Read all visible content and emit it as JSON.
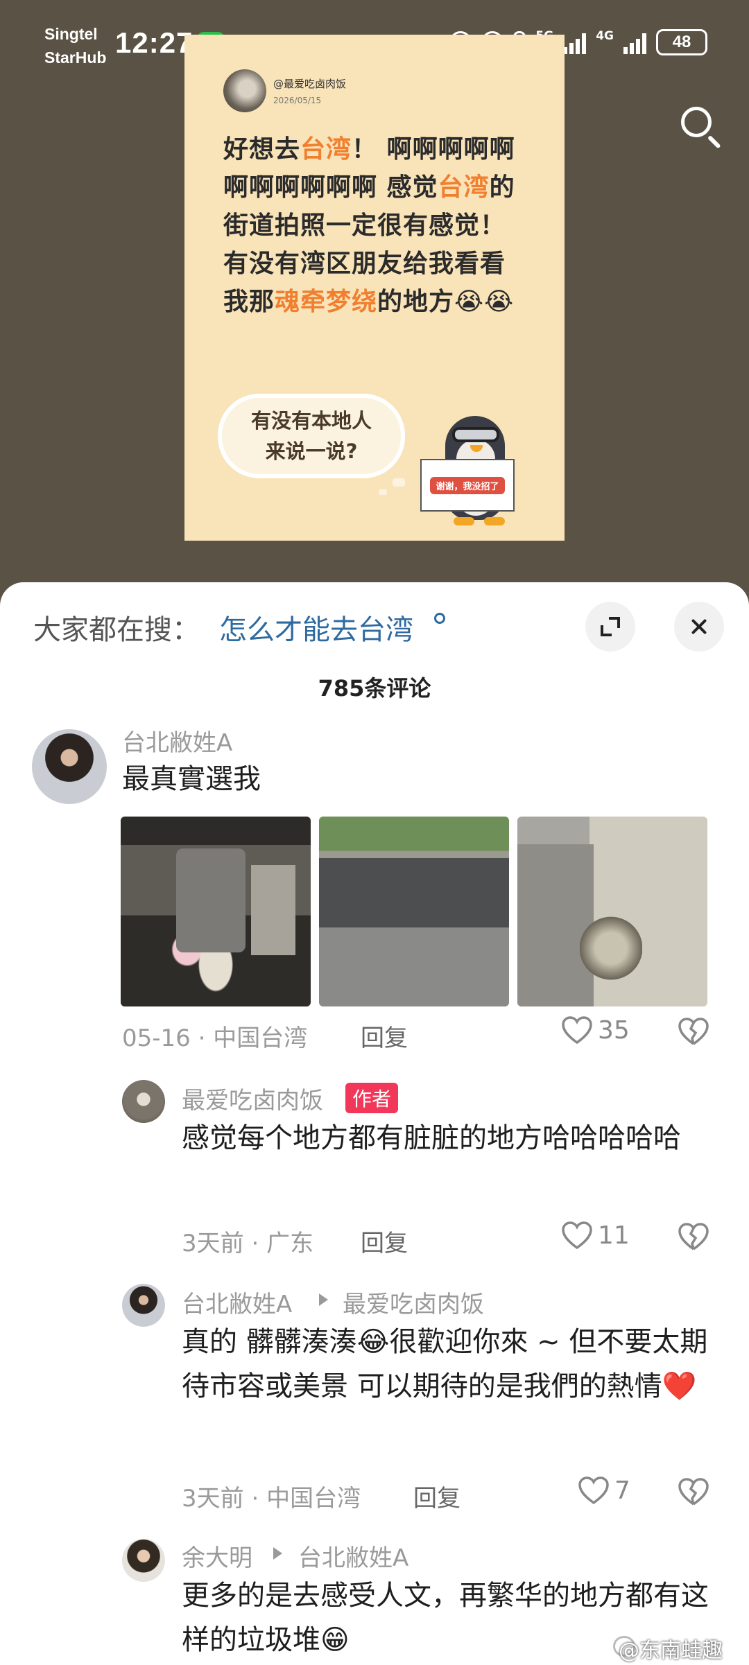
{
  "status_bar": {
    "carrier_1": "Singtel",
    "carrier_2": "StarHub",
    "time": "12:27",
    "net_1": "5G",
    "net_2": "4G",
    "battery": "48"
  },
  "post": {
    "username": "@最爱吃卤肉饭",
    "date": "2026/05/15",
    "text_parts": [
      "好想去",
      "台湾",
      "！ 啊啊啊啊啊啊啊啊啊啊啊 感觉",
      "台湾",
      "的街道拍照一定很有感觉！有没有湾区朋友给我看看我那",
      "魂牵梦绕",
      "的地方😭😭"
    ],
    "bubble_line_1": "有没有本地人",
    "bubble_line_2": "来说一说?",
    "sign_text": "谢谢，我没招了"
  },
  "sheet": {
    "hint_label": "大家都在搜：",
    "hint_query": "怎么才能去台湾",
    "comment_count": "785条评论"
  },
  "comments": [
    {
      "user": "台北敝姓A",
      "text": "最真實選我",
      "date": "05-16",
      "location": "中国台湾",
      "reply": "回复",
      "likes": "35"
    },
    {
      "user": "最爱吃卤肉饭",
      "badge": "作者",
      "text": "感觉每个地方都有脏脏的地方哈哈哈哈哈",
      "date": "3天前",
      "location": "广东",
      "reply": "回复",
      "likes": "11"
    },
    {
      "user": "台北敝姓A",
      "reply_to": "最爱吃卤肉饭",
      "text": "真的 髒髒湊湊😂很歡迎你來 ~ 但不要太期待市容或美景 可以期待的是我們的熱情❤️",
      "date": "3天前",
      "location": "中国台湾",
      "reply": "回复",
      "likes": "7"
    },
    {
      "user": "余大明",
      "reply_to": "台北敝姓A",
      "text": "更多的是去感受人文，再繁华的地方都有这样的垃圾堆😁"
    }
  ],
  "watermark": "@东南蛙趣"
}
